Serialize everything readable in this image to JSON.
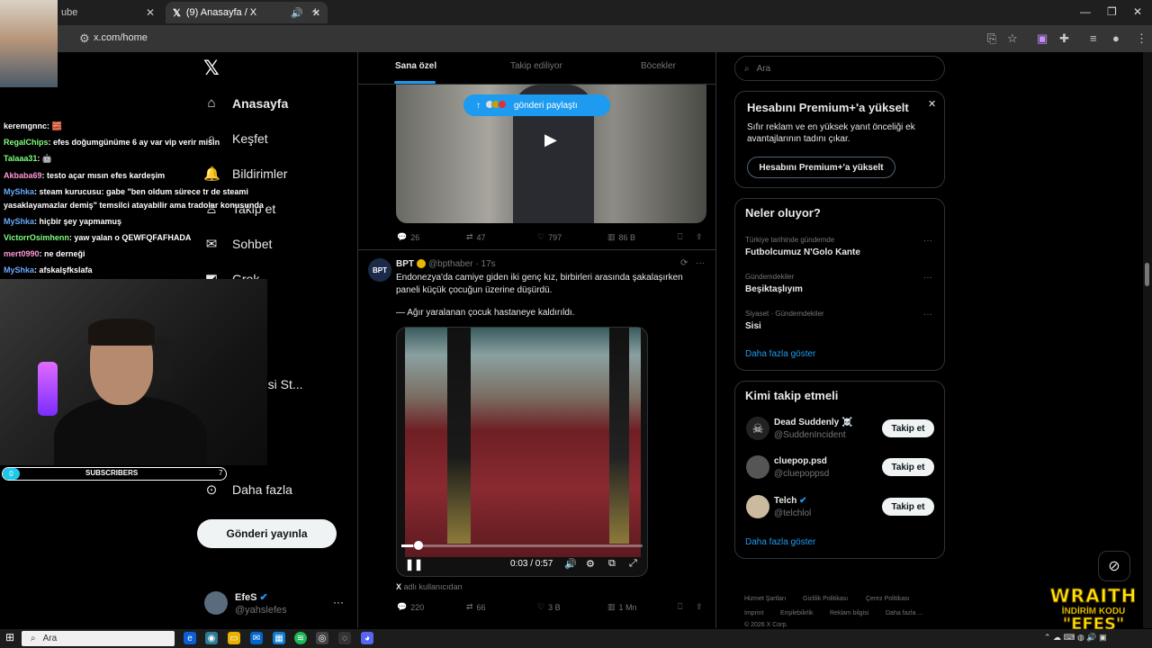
{
  "browser": {
    "tabs": [
      {
        "label": "ube"
      },
      {
        "label": "(9) Anasayfa / X"
      }
    ],
    "new_tab": "+",
    "url": "x.com/home",
    "window_controls": {
      "minimize": "—",
      "restore": "❐",
      "close": "✕"
    }
  },
  "nav": {
    "logo": "𝕏",
    "items": [
      {
        "label": "Anasayfa",
        "icon": "home-icon"
      },
      {
        "label": "Keşfet",
        "icon": "search-icon"
      },
      {
        "label": "Bildirimler",
        "icon": "bell-icon"
      },
      {
        "label": "Takip et",
        "icon": "person-icon"
      },
      {
        "label": "Sohbet",
        "icon": "mail-icon"
      },
      {
        "label": "Grok",
        "icon": "grok-icon"
      },
      {
        "label": "Premium",
        "icon": "premium-icon"
      },
      {
        "label": "Sertifikalı Kuruluşlar",
        "icon": "lightning-icon"
      },
      {
        "label": "İçerik Üreticisi St...",
        "icon": "studio-icon"
      },
      {
        "label": "Profil",
        "icon": "profile-icon"
      },
      {
        "label": "Daha fazla",
        "icon": "more-icon"
      }
    ],
    "visible_labels": {
      "home": "Anasayfa",
      "explore": "Keşfet",
      "notifications": "Bildirimler",
      "follow": "Takip et",
      "chat": "Sohbet",
      "grok": "Grok",
      "premium": "um",
      "orgs": "retleri",
      "studio": "Üreticisi St...",
      "profile": "eler",
      "more": "Daha fazla"
    },
    "notif_badge": "9",
    "post_button": "Gönderi yayınla",
    "account": {
      "name": "EfeS",
      "handle": "@yahslefes",
      "more": "···"
    }
  },
  "feed": {
    "tabs": [
      {
        "label": "Sana özel",
        "active": true
      },
      {
        "label": "Takip ediliyor",
        "active": false
      },
      {
        "label": "Böcekler",
        "active": false
      }
    ],
    "share_pill": "gönderi paylaştı",
    "post1_actions": {
      "replies": "26",
      "reposts": "47",
      "likes": "797",
      "views": "86 B"
    },
    "post2": {
      "name": "BPT",
      "handle": "@bpthaber · 17s",
      "avatar_text": "BPT",
      "text": "Endonezya'da camiye giden iki genç kız, birbirleri arasında şakalaşırken paneli küçük çocuğun üzerine düşürdü.",
      "text2": "— Ağır yaralanan çocuk hastaneye kaldırıldı.",
      "video_time": "0:03 / 0:57",
      "progress": 0.05,
      "source_prefix": "X",
      "source": "adlı kullanıcıdan",
      "actions": {
        "replies": "220",
        "reposts": "66",
        "likes": "3 B",
        "views": "1 Mn"
      }
    }
  },
  "right": {
    "search_placeholder": "Ara",
    "premium": {
      "title": "Hesabını Premium+'a yükselt",
      "body": "Sıfır reklam ve en yüksek yanıt önceliği ek avantajlarının tadını çıkar.",
      "button": "Hesabını Premium+'a yükselt",
      "close": "✕"
    },
    "trends": {
      "title": "Neler oluyor?",
      "items": [
        {
          "context": "Türkiye tarihinde gündemde",
          "name": "Futbolcumuz N'Golo Kante"
        },
        {
          "context": "Gündemdekiler",
          "name": "Beşiktaşlıyım"
        },
        {
          "context": "Siyaset · Gündemdekiler",
          "name": "Sisi"
        }
      ],
      "more_link": "Daha fazla göster"
    },
    "who": {
      "title": "Kimi takip etmeli",
      "items": [
        {
          "name": "Dead Suddenly ☠️",
          "handle": "@SuddenIncident",
          "button": "Takip et"
        },
        {
          "name": "cluepop.psd",
          "handle": "@cluepoppsd",
          "button": "Takip et"
        },
        {
          "name": "Telch",
          "handle": "@telchlol",
          "button": "Takip et"
        }
      ],
      "more_link": "Daha fazla göster"
    },
    "footer": {
      "row1": [
        "Hizmet Şartları",
        "Gizlilik Politikası",
        "Çerez Politikası"
      ],
      "row2": [
        "Imprint",
        "Erişilebilirlik",
        "Reklam bilgisi",
        "Daha fazla ..."
      ],
      "copyright": "© 2026 X Corp."
    }
  },
  "stream": {
    "chat": [
      {
        "user": "keremgnnc",
        "msg": ": 🧱",
        "color": "#ffffff"
      },
      {
        "user": "RegalChips",
        "msg": ": efes doğumgünüme 6 ay var vip verir misin",
        "color": "#7fff7f"
      },
      {
        "user": "Talaaa31",
        "msg": ": 🤖",
        "color": "#7fff7f"
      },
      {
        "user": "Akbaba69",
        "msg": ": testo açar mısın efes kardeşim",
        "color": "#ff9ad5"
      },
      {
        "user": "MyShka",
        "msg": ": steam kurucusu: gabe \"ben oldum sürece tr de steami",
        "color": "#6aa9ff"
      },
      {
        "user": "",
        "msg": "yasaklayamazlar demiş\" temsilci atayabilir ama tradolar konusunda",
        "color": "#ffffff"
      },
      {
        "user": "MyShka",
        "msg": ": hiçbir şey yapmamuş",
        "color": "#6aa9ff"
      },
      {
        "user": "VictorrOsimhenn",
        "msg": ": yaw yalan o QEWFQFAFHADA",
        "color": "#7fff7f"
      },
      {
        "user": "mert0990",
        "msg": ": ne derneği",
        "color": "#ff9ad5"
      },
      {
        "user": "MyShka",
        "msg": ": afskalşfkslafa",
        "color": "#6aa9ff"
      }
    ],
    "subs": {
      "current": "0",
      "label": "SUBSCRIBERS",
      "goal": "7"
    },
    "sponsor": {
      "title": "WRAITH",
      "subtitle": "İNDİRİM KODU",
      "code": "\"EFES\""
    }
  },
  "taskbar": {
    "search": "Ara"
  }
}
